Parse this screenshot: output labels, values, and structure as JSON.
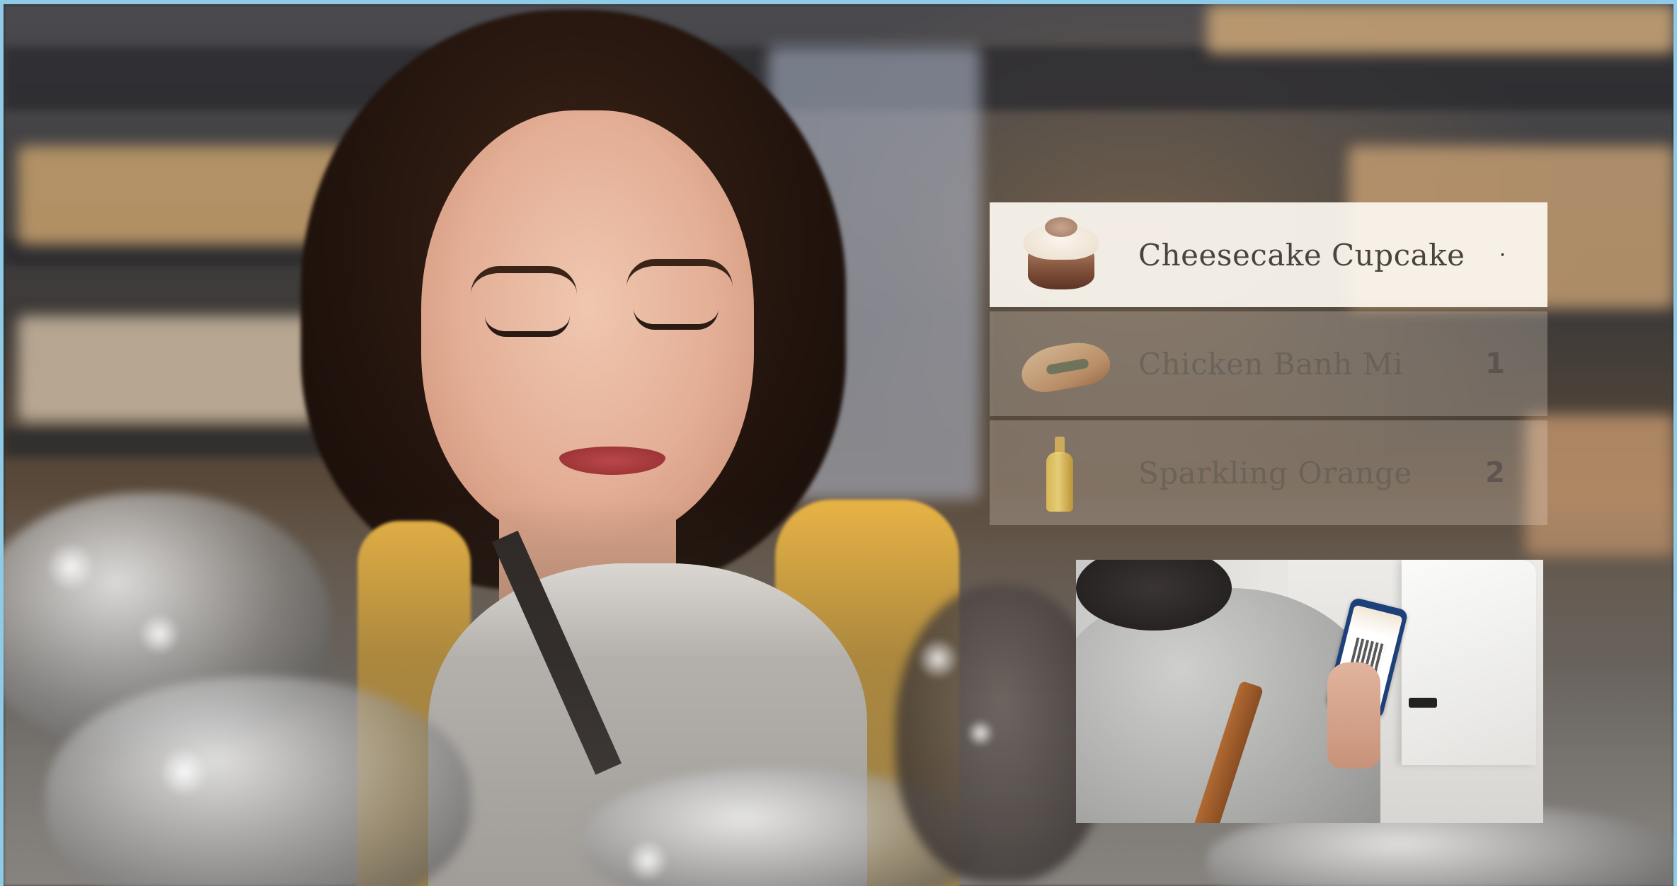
{
  "cart": {
    "items": [
      {
        "name": "Cheesecake Cupcake",
        "qty": "·",
        "icon": "cupcake-icon",
        "state": "active"
      },
      {
        "name": "Chicken Banh Mi",
        "qty": "1",
        "icon": "sandwich-icon",
        "state": "faded"
      },
      {
        "name": "Sparkling Orange",
        "qty": "2",
        "icon": "bottle-icon",
        "state": "faded"
      }
    ]
  },
  "colors": {
    "frame_border": "#8fcbe6",
    "active_row": "#fcf7f0",
    "cardigan": "#e7b345"
  }
}
